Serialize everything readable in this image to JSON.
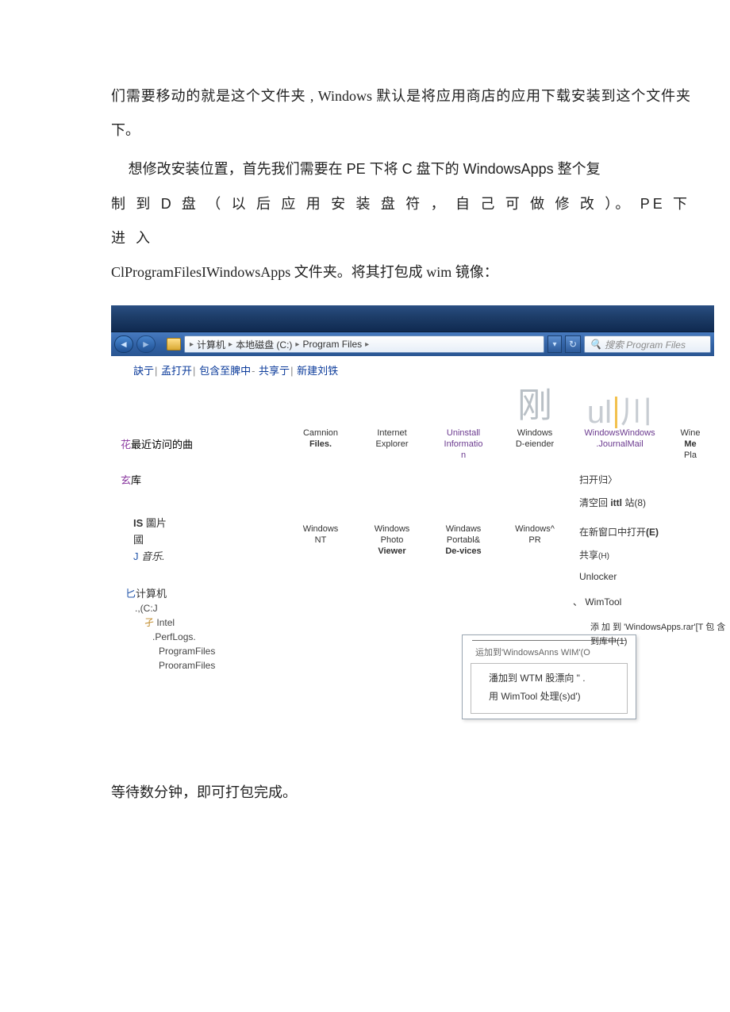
{
  "doc": {
    "p1": "们需要移动的就是这个文件夹 , Windows 默认是将应用商店的应用下载安装到这个文件夹下。",
    "p2_a": "想修改安装位置，首先我们需要在 PE 下将 C 盘下的 WindowsApps 整个复",
    "p2_b": "制 到  D  盘 （ 以 后 应 用 安 装 盘 符 ， 自 己 可 做 修 改 ）。 PE  下 进 入",
    "p2_c": "ClProgramFilesIWindowsApps 文件夹。将其打包成 wim 镜像：",
    "p3": "等待数分钟，即可打包完成。"
  },
  "explorer": {
    "breadcrumb": {
      "seg1": "计算机",
      "seg2": "本地磁盘 (C:)",
      "seg3": "Program Files"
    },
    "search_placeholder": "搜索 Program Files",
    "menubar": {
      "a": "訣亍",
      "b": "孟打开",
      "c": "包含至脾中",
      "d": "共享亍",
      "e": "新建刘铁"
    },
    "nav": {
      "s1": {
        "prefix": "花",
        "label": "最近访问的曲"
      },
      "s2": {
        "prefix": "玄",
        "label": "库"
      },
      "pic": {
        "prefix": "IS",
        "label": "圖片"
      },
      "guo": "國",
      "music": {
        "prefix": "J",
        "label": "音乐."
      },
      "comp": {
        "prefix": "匕",
        "label": "计算机"
      },
      "c": ".,(C:J",
      "intel": "Intel",
      "intel_pre": "孑",
      "perflogs": ".PerfLogs.",
      "pf1": "ProgramFiles",
      "pf2": "ProoramFiles"
    },
    "row1": {
      "f1": {
        "l1": "Camnion",
        "l2": "Files."
      },
      "f2": {
        "l1": "Internet",
        "l2": "Explorer"
      },
      "f3": {
        "l1": "Uninstall",
        "l2": "Informatio",
        "l3": "n"
      },
      "f4": {
        "l1": "Windows",
        "l2": "D-eiender"
      },
      "glyph1": "刚",
      "f5": {
        "l1": "WindowsWindows",
        "l2": ".JournalMail"
      },
      "glyph2": "ul",
      "glyph3": "川",
      "f6": {
        "l1": "Wine",
        "l2": "Me",
        "l3": "Pla"
      }
    },
    "row2": {
      "f1": {
        "l1": "Windows",
        "l2": "NT"
      },
      "f2": {
        "l1": "Windows",
        "l2": "Photo",
        "l3": "Viewer"
      },
      "f3": {
        "l1": "Windaws",
        "l2": "Portabl&",
        "l3": "De-vices"
      },
      "f4": {
        "l1": "Windows^",
        "l2": "PR"
      }
    },
    "ctx": {
      "caption": "运加到'WindowsAnns WIM'(O",
      "i1": "潘加到 WTM 股漂向 \" .",
      "i2": "用 WimTool 处理(s)d')"
    },
    "rmenu": {
      "i1": "扫开归〉",
      "i2a": "清空回 ",
      "i2b": "ittl",
      "i2c": " 站(8)",
      "i3a": "在新窗口中打开",
      "i3b": "(E)",
      "i4a": "共享",
      "i4b": "(H)",
      "i5": "Unlocker",
      "i6": "、 WimTool",
      "i7": "添 加 到 'WindowsApps.rar'[T  包 含 到库中(1)"
    }
  }
}
